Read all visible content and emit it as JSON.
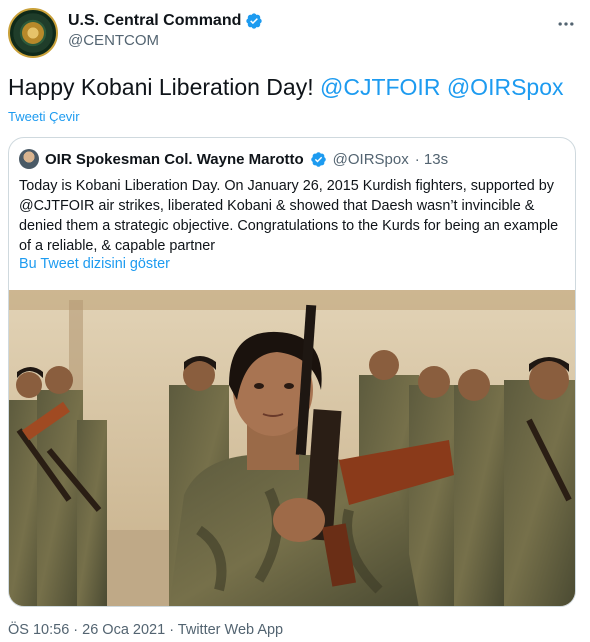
{
  "tweet": {
    "author": {
      "display_name": "U.S. Central Command",
      "handle": "@CENTCOM"
    },
    "text_plain": "Happy Kobani Liberation Day! ",
    "mentions": [
      "@CJTFOIR",
      "@OIRSpox"
    ],
    "translate_label": "Tweeti Çevir",
    "timestamp": "ÖS 10:56 · 26 Oca 2021 · Twitter Web App"
  },
  "quoted_tweet": {
    "author": {
      "display_name": "OIR Spokesman Col. Wayne Marotto",
      "handle": "@OIRSpox",
      "time": "· 13s"
    },
    "text": "Today is Kobani Liberation Day. On January 26, 2015 Kurdish fighters, supported by @CJTFOIR air strikes, liberated  Kobani & showed that Daesh wasn’t invincible & denied them a strategic objective. Congratulations to the Kurds for being an example of a reliable, & capable partner",
    "show_thread_label": "Bu Tweet dizisini göster"
  },
  "colors": {
    "accent": "#1d9bf0",
    "text": "#0f1419",
    "secondary": "#536471",
    "border": "#cfd9de"
  }
}
